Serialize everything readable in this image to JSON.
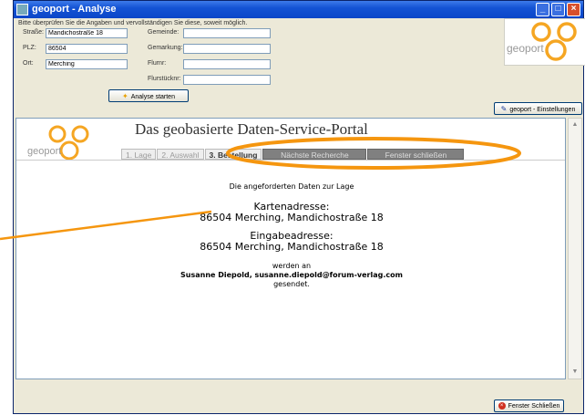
{
  "window": {
    "title": "geoport - Analyse"
  },
  "form": {
    "instructions": "Bitte überprüfen Sie die Angaben und vervollständigen Sie diese, soweit möglich.",
    "strasse_label": "Straße:",
    "strasse_value": "Mandichostraße 18",
    "plz_label": "PLZ:",
    "plz_value": "86504",
    "ort_label": "Ort:",
    "ort_value": "Merching",
    "gemeinde_label": "Gemeinde:",
    "gemeinde_value": "",
    "gemarkung_label": "Gemarkung:",
    "gemarkung_value": "",
    "flurnr_label": "Flurnr:",
    "flurnr_value": "",
    "flurstuecknr_label": "Flurstücknr:",
    "flurstuecknr_value": "",
    "analyse_button": "Analyse starten"
  },
  "brand": {
    "logo_text": "geoport",
    "logo_color": "#f5a623"
  },
  "settings_button": "geoport - Einstellungen",
  "portal": {
    "title": "Das geobasierte Daten-Service-Portal",
    "tabs": [
      {
        "label": "1. Lage",
        "state": "inactive"
      },
      {
        "label": "2. Auswahl",
        "state": "inactive"
      },
      {
        "label": "3. Bestellung",
        "state": "active"
      },
      {
        "label": "Nächste Recherche",
        "state": "dark"
      },
      {
        "label": "Fenster schließen",
        "state": "dark"
      }
    ]
  },
  "message": {
    "intro": "Die angeforderten Daten zur Lage",
    "karten_heading": "Kartenadresse:",
    "karten_address": "86504 Merching, Mandichostraße 18",
    "eingabe_heading": "Eingabeadresse:",
    "eingabe_address": "86504 Merching, Mandichostraße 18",
    "werden_an": "werden an",
    "recipient": "Susanne Diepold, susanne.diepold@forum-verlag.com",
    "gesendet": "gesendet."
  },
  "close_button": "Fenster Schließen",
  "colors": {
    "highlight": "#f5960f",
    "titlebar": "#1453d4"
  }
}
